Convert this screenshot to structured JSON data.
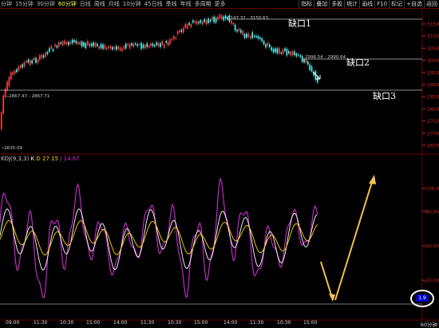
{
  "toolbar": {
    "period_tabs": [
      "分钟",
      "15分钟",
      "30分钟",
      "60分钟",
      "日线",
      "周线",
      "月线",
      "10分钟",
      "45日线",
      "季线",
      "年线",
      "多周期",
      "更多"
    ],
    "active_tab": "60分钟",
    "tool_tabs": [
      "指标",
      "叠加",
      "多股",
      "统计",
      "画线",
      "F10",
      "标记",
      "+自选",
      "返回"
    ]
  },
  "price_chart": {
    "y_ticks": [
      "3150",
      "3100",
      "3050",
      "3000",
      "2950",
      "2900",
      "2850",
      "2800",
      "2750",
      "2700",
      "2650"
    ],
    "high_label": "3147.37 - 3150.63",
    "gap2_label": "2996.54 - 2990.64",
    "gap3_label": "2867.47 - 2867.71",
    "low_label": "2635.09",
    "gap_names": [
      "缺口1",
      "缺口2",
      "缺口3"
    ]
  },
  "stoch": {
    "header_name": "KDJ(9,3,3)",
    "k_label": "K",
    "k_value": "",
    "d_label": "D",
    "d_value": "27.15",
    "j_label": "J",
    "j_value": "14.67",
    "y_ticks": [
      "100.00",
      "80.00",
      "50.00",
      "20.00"
    ],
    "badge": "1.9"
  },
  "x_axis": {
    "ticks": [
      "09:00",
      "11:30",
      "10:30",
      "15:00",
      "14:00",
      "11:30",
      "10:30",
      "15:00",
      "14:00",
      "11:30",
      "10:30",
      "15:00"
    ],
    "period_label": "60分钟"
  },
  "colors": {
    "background": "#000000",
    "bull_candle": "#ff4848",
    "bear_candle": "#54ffff",
    "k_line": "#ffffff",
    "d_line": "#ffd700",
    "j_line": "#d12bd1",
    "arrow": "#f2c24b",
    "grid_line": "#6b0000",
    "tick_text": "#c82828",
    "highlight_circle": "#ffffff"
  }
}
